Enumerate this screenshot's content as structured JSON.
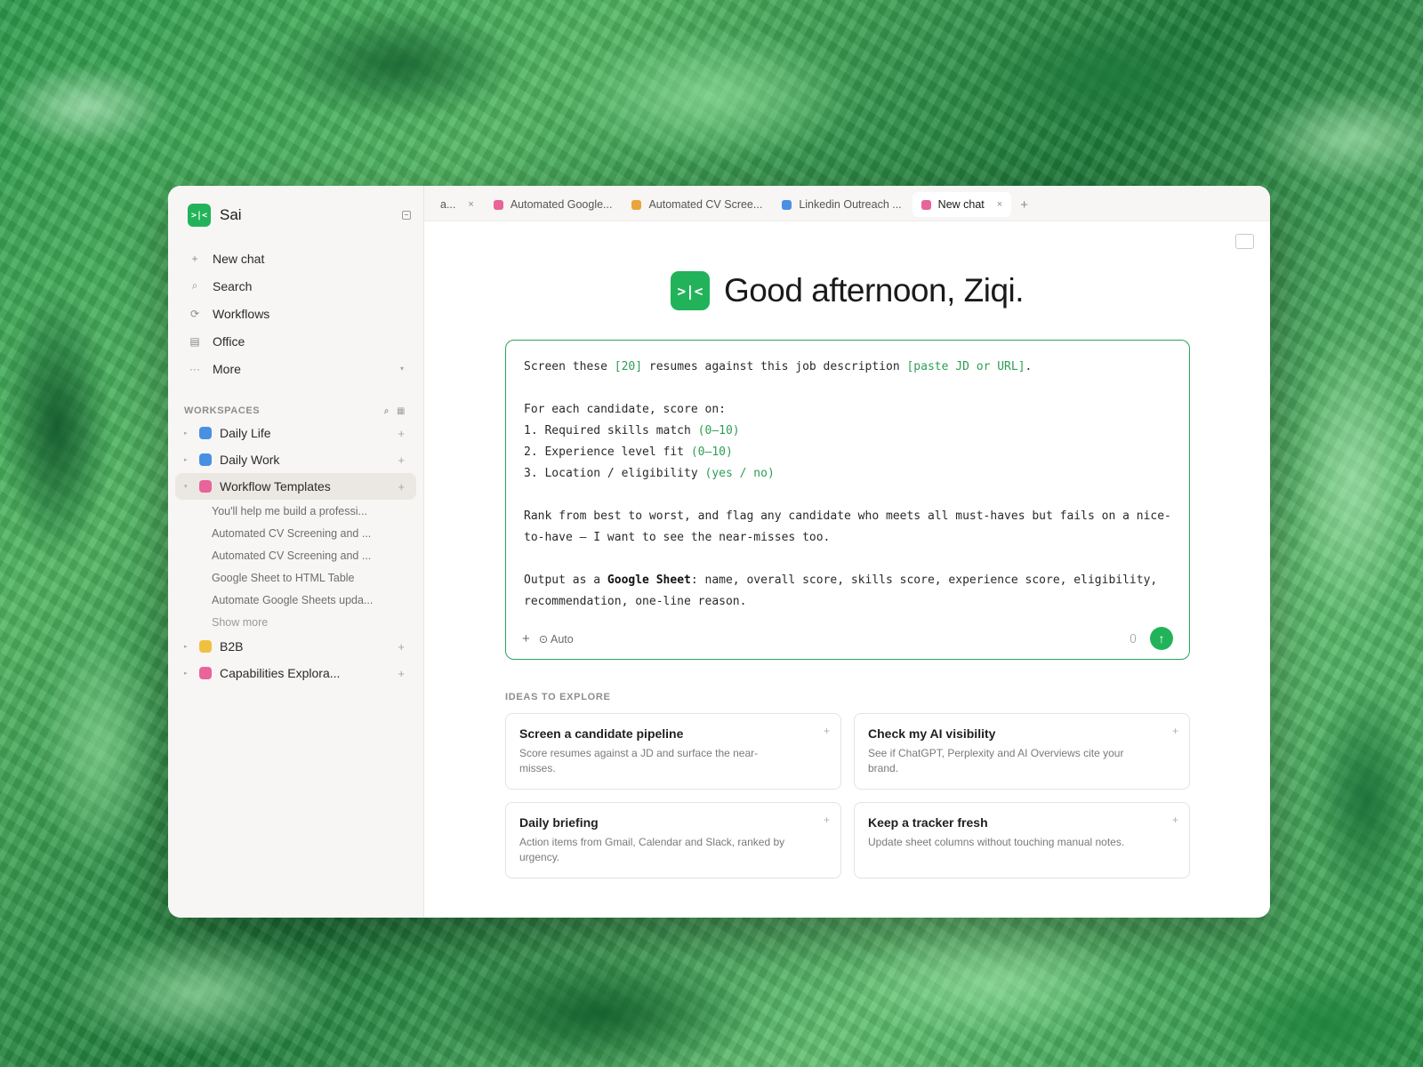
{
  "colors": {
    "accent": "#22b35a",
    "pink": "#e8649b",
    "blue": "#4a90e2",
    "orange": "#eaa43a",
    "yellow": "#f0c040"
  },
  "sidebar": {
    "app_name": "Sai",
    "logo_text": ">|<",
    "nav": [
      {
        "label": "New chat",
        "icon": "plus-icon"
      },
      {
        "label": "Search",
        "icon": "search-icon"
      },
      {
        "label": "Workflows",
        "icon": "refresh-icon"
      },
      {
        "label": "Office",
        "icon": "document-icon"
      },
      {
        "label": "More",
        "icon": "ellipsis-icon"
      }
    ],
    "workspaces_label": "WORKSPACES",
    "workspaces": [
      {
        "label": "Daily Life",
        "color": "#4a90e2"
      },
      {
        "label": "Daily Work",
        "color": "#4a90e2"
      },
      {
        "label": "Workflow Templates",
        "color": "#e8649b"
      },
      {
        "label": "B2B",
        "color": "#f0c040"
      },
      {
        "label": "Capabilities Explora...",
        "color": "#e8649b"
      }
    ],
    "sub_items": [
      "You'll help me build a professi...",
      "Automated CV Screening and ...",
      "Automated CV Screening and ...",
      "Google Sheet to HTML Table",
      "Automate Google Sheets upda..."
    ],
    "show_more": "Show more"
  },
  "tabs": [
    {
      "label": "a...",
      "color": "",
      "close": "×"
    },
    {
      "label": "Automated Google...",
      "color": "#e8649b"
    },
    {
      "label": "Automated CV Scree...",
      "color": "#eaa43a"
    },
    {
      "label": "Linkedin Outreach ...",
      "color": "#4a90e2"
    },
    {
      "label": "New chat",
      "color": "#e8649b",
      "close": "×"
    }
  ],
  "greeting": "Good afternoon, Ziqi.",
  "composer": {
    "line1": [
      "Screen these ",
      "[20]",
      " resumes against this job description ",
      "[paste JD or URL]",
      "."
    ],
    "line2": "For each candidate, score on:",
    "line3": [
      "1. Required skills match ",
      "(0–10)"
    ],
    "line4": [
      "2. Experience level fit ",
      "(0–10)"
    ],
    "line5": [
      "3. Location / eligibility ",
      "(yes / no)"
    ],
    "line6": "Rank from best to worst, and flag any candidate who meets all must-haves but fails on a nice-to-have — I want to see the near-misses too.",
    "line7": [
      "Output as a ",
      "Google Sheet",
      ": name, overall score, skills score, experience score, eligibility, recommendation, one-line reason."
    ],
    "mode": "⊙ Auto"
  },
  "ideas": {
    "title": "IDEAS TO EXPLORE",
    "cards": [
      {
        "title": "Screen a candidate pipeline",
        "desc": "Score resumes against a JD and surface the near-misses."
      },
      {
        "title": "Check my AI visibility",
        "desc": "See if ChatGPT, Perplexity and AI Overviews cite your brand."
      },
      {
        "title": "Daily briefing",
        "desc": "Action items from Gmail, Calendar and Slack, ranked by urgency."
      },
      {
        "title": "Keep a tracker fresh",
        "desc": "Update sheet columns without touching manual notes."
      }
    ]
  }
}
